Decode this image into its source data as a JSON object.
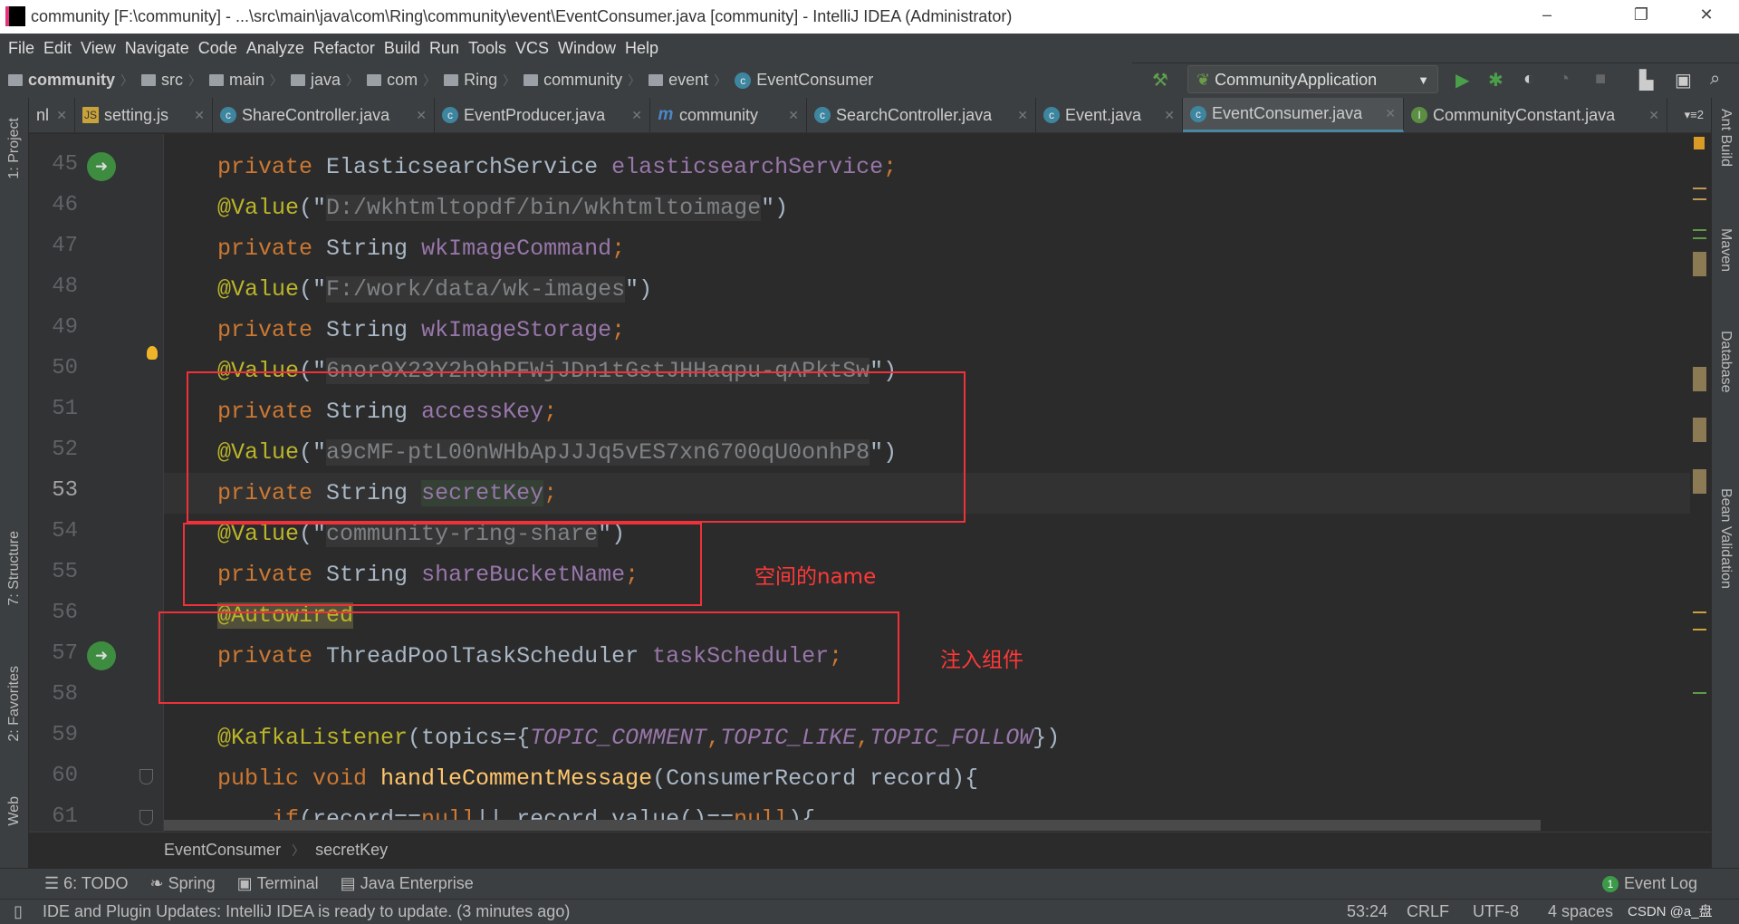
{
  "window": {
    "title": "community [F:\\community] - ...\\src\\main\\java\\com\\Ring\\community\\event\\EventConsumer.java [community] - IntelliJ IDEA (Administrator)",
    "minimize": "–",
    "maximize": "❐",
    "close": "✕"
  },
  "menu": [
    "File",
    "Edit",
    "View",
    "Navigate",
    "Code",
    "Analyze",
    "Refactor",
    "Build",
    "Run",
    "Tools",
    "VCS",
    "Window",
    "Help"
  ],
  "breadcrumbs": [
    "community",
    "src",
    "main",
    "java",
    "com",
    "Ring",
    "community",
    "event",
    "EventConsumer"
  ],
  "run_config": "CommunityApplication",
  "tabs": [
    {
      "label": "nl"
    },
    {
      "label": "setting.js"
    },
    {
      "label": "ShareController.java"
    },
    {
      "label": "EventProducer.java"
    },
    {
      "label": "community"
    },
    {
      "label": "SearchController.java"
    },
    {
      "label": "Event.java"
    },
    {
      "label": "EventConsumer.java",
      "active": true
    },
    {
      "label": "CommunityConstant.java"
    }
  ],
  "tabs_overflow": "▾≡2",
  "left_stripe": {
    "project": "1: Project",
    "structure": "7: Structure",
    "favorites": "2: Favorites",
    "web": "Web"
  },
  "right_stripe": [
    "Ant Build",
    "Maven",
    "Database",
    "Bean Validation"
  ],
  "code_lines": [
    {
      "n": "45",
      "tokens": [
        [
          "private ",
          "kw"
        ],
        [
          "ElasticsearchService ",
          "df"
        ],
        [
          "elasticsearchService",
          "fd"
        ],
        [
          ";",
          "kw"
        ]
      ]
    },
    {
      "n": "46",
      "tokens": [
        [
          "@Value",
          "an"
        ],
        [
          "(\"",
          "df"
        ],
        [
          "D:/wkhtmltopdf/bin/wkhtmltoimage",
          "st"
        ],
        [
          "\")",
          "df"
        ]
      ]
    },
    {
      "n": "47",
      "tokens": [
        [
          "private ",
          "kw"
        ],
        [
          "String ",
          "df"
        ],
        [
          "wkImageCommand",
          "fd"
        ],
        [
          ";",
          "kw"
        ]
      ]
    },
    {
      "n": "48",
      "tokens": [
        [
          "@Value",
          "an"
        ],
        [
          "(\"",
          "df"
        ],
        [
          "F:/work/data/wk-images",
          "st"
        ],
        [
          "\")",
          "df"
        ]
      ]
    },
    {
      "n": "49",
      "tokens": [
        [
          "private ",
          "kw"
        ],
        [
          "String ",
          "df"
        ],
        [
          "wkImageStorage",
          "fd"
        ],
        [
          ";",
          "kw"
        ]
      ]
    },
    {
      "n": "50",
      "tokens": [
        [
          "@Value",
          "an"
        ],
        [
          "(\"",
          "df"
        ],
        [
          "6nor9X23Y2h9hPFWjJDn1tGstJHHaqpu-qAPktSw",
          "st"
        ],
        [
          "\")",
          "df"
        ]
      ]
    },
    {
      "n": "51",
      "tokens": [
        [
          "private ",
          "kw"
        ],
        [
          "String ",
          "df"
        ],
        [
          "accessKey",
          "fd"
        ],
        [
          ";",
          "kw"
        ]
      ]
    },
    {
      "n": "52",
      "tokens": [
        [
          "@Value",
          "an"
        ],
        [
          "(\"",
          "df"
        ],
        [
          "a9cMF-ptL00nWHbApJJJq5vES7xn6700qU0onhP8",
          "st"
        ],
        [
          "\")",
          "df"
        ]
      ]
    },
    {
      "n": "53",
      "tokens": [
        [
          "private ",
          "kw"
        ],
        [
          "String ",
          "df"
        ],
        [
          "secretKey",
          "fd sel"
        ],
        [
          ";",
          "kw"
        ]
      ]
    },
    {
      "n": "54",
      "tokens": [
        [
          "@Value",
          "an"
        ],
        [
          "(\"",
          "df"
        ],
        [
          "community-ring-share",
          "st"
        ],
        [
          "\")",
          "df"
        ]
      ]
    },
    {
      "n": "55",
      "tokens": [
        [
          "private ",
          "kw"
        ],
        [
          "String ",
          "df"
        ],
        [
          "shareBucketName",
          "fd"
        ],
        [
          ";",
          "kw"
        ]
      ]
    },
    {
      "n": "56",
      "tokens": [
        [
          "@Autowired",
          "an2"
        ]
      ]
    },
    {
      "n": "57",
      "tokens": [
        [
          "private ",
          "kw"
        ],
        [
          "ThreadPoolTaskScheduler ",
          "df"
        ],
        [
          "taskScheduler",
          "fd"
        ],
        [
          ";",
          "kw"
        ]
      ]
    },
    {
      "n": "58",
      "tokens": []
    },
    {
      "n": "59",
      "tokens": [
        [
          "@KafkaListener",
          "an"
        ],
        [
          "(topics={",
          "df"
        ],
        [
          "TOPIC_COMMENT",
          "cn"
        ],
        [
          ",",
          "kw"
        ],
        [
          "TOPIC_LIKE",
          "cn"
        ],
        [
          ",",
          "kw"
        ],
        [
          "TOPIC_FOLLOW",
          "cn"
        ],
        [
          "})",
          "df"
        ]
      ]
    },
    {
      "n": "60",
      "tokens": [
        [
          "public void ",
          "kw"
        ],
        [
          "handleCommentMessage",
          "mt"
        ],
        [
          "(ConsumerRecord record){",
          "df"
        ]
      ]
    },
    {
      "n": "61",
      "tokens": [
        [
          "    if",
          "kw"
        ],
        [
          "(record==",
          "df"
        ],
        [
          "null",
          "kw"
        ],
        [
          "|| record.value()==",
          "df"
        ],
        [
          "null",
          "kw"
        ],
        [
          "){",
          "df"
        ]
      ]
    }
  ],
  "annotations": {
    "bucket_note": "空间的name",
    "inject_note": "注入组件"
  },
  "editor_breadcrumb": [
    "EventConsumer",
    "secretKey"
  ],
  "tool_windows": [
    {
      "label": "6: TODO"
    },
    {
      "label": "Spring"
    },
    {
      "label": "Terminal"
    },
    {
      "label": "Java Enterprise"
    }
  ],
  "event_log": {
    "label": "Event Log",
    "count": "1"
  },
  "status": {
    "message": "IDE and Plugin Updates: IntelliJ IDEA is ready to update. (3 minutes ago)",
    "position": "53:24",
    "line_sep": "CRLF",
    "encoding": "UTF-8",
    "indent": "4 spaces",
    "watermark": "CSDN @a_盘"
  },
  "colors": {
    "keyword": "#cc7832",
    "annotation": "#bbb529",
    "field": "#9876aa",
    "text": "#a9b7c6",
    "highlight_box": "#f0313a"
  }
}
